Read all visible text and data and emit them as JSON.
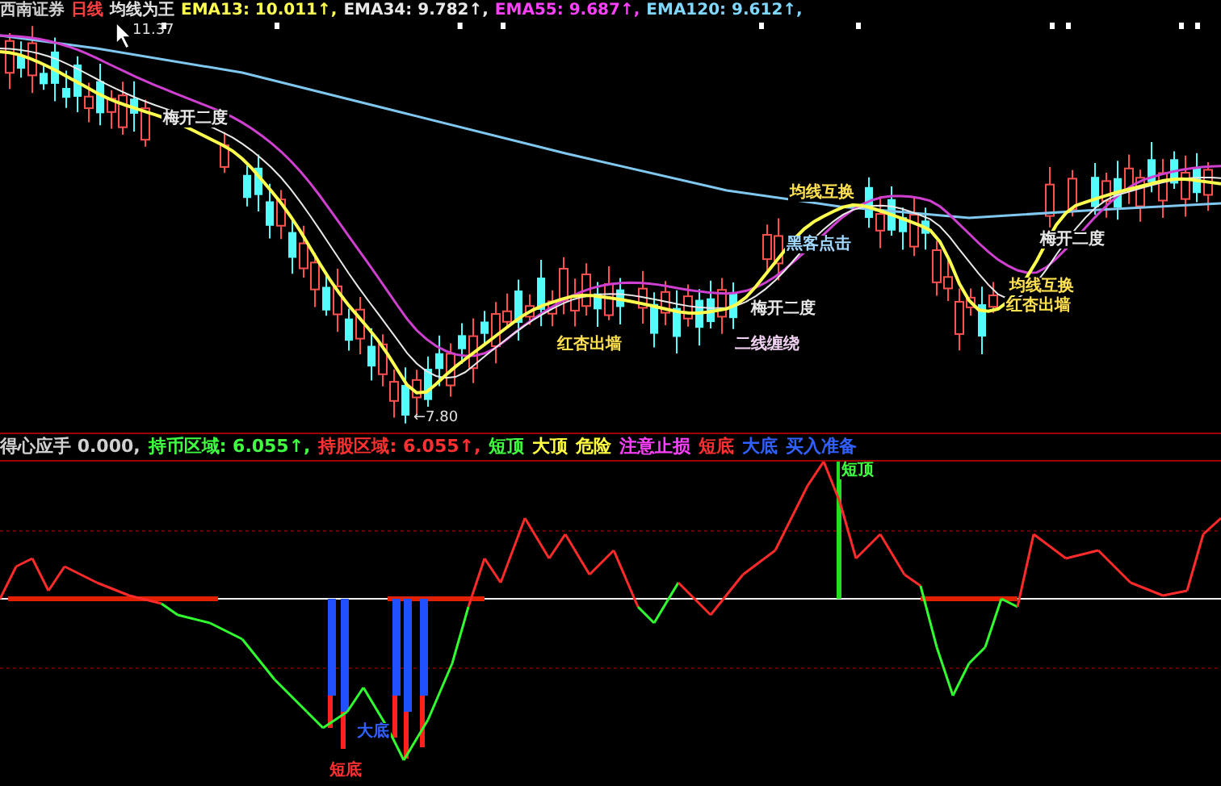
{
  "price_panel": {
    "legend": [
      {
        "text": "西南证券",
        "color": "#d0d0d0"
      },
      {
        "text": "日线",
        "color": "#ff4040"
      },
      {
        "text": "均线为王",
        "color": "#e0e0e0"
      },
      {
        "text": "EMA13: 10.011↑,",
        "color": "#ffff50"
      },
      {
        "text": "EMA34: 9.782↑,",
        "color": "#e8e8e8"
      },
      {
        "text": "EMA55: 9.687↑,",
        "color": "#ff40ff"
      },
      {
        "text": "EMA120: 9.612↑,",
        "color": "#80d8ff"
      }
    ],
    "price_labels": [
      {
        "text": "11.37"
      },
      {
        "text": "←7.80"
      }
    ],
    "annotations": [
      {
        "text": "梅开二度",
        "color": "#e8e8e8"
      },
      {
        "text": "均线互换",
        "color": "#ffe050"
      },
      {
        "text": "红杏出墙",
        "color": "#ffe050"
      },
      {
        "text": "梅开二度",
        "color": "#e8e8e8"
      },
      {
        "text": "黑客点击",
        "color": "#a0d8ff"
      },
      {
        "text": "二线缠绕",
        "color": "#f0d0f0"
      },
      {
        "text": "梅开二度",
        "color": "#e8e8e8"
      },
      {
        "text": "均线互换",
        "color": "#ffe050"
      },
      {
        "text": "红杏出墙",
        "color": "#ffe050"
      }
    ]
  },
  "indicator_panel": {
    "legend": [
      {
        "text": "得心应手 0.000,",
        "color": "#d0d0d0"
      },
      {
        "text": "持币区域: 6.055↑,",
        "color": "#40ff40"
      },
      {
        "text": "持股区域: 6.055↑,",
        "color": "#ff3030"
      },
      {
        "text": "短顶",
        "color": "#40ff40"
      },
      {
        "text": "大顶",
        "color": "#ffff40"
      },
      {
        "text": "危险",
        "color": "#ffff40"
      },
      {
        "text": "注意止损",
        "color": "#ff40ff"
      },
      {
        "text": "短底",
        "color": "#ff3030"
      },
      {
        "text": "大底",
        "color": "#3060ff"
      },
      {
        "text": "买入准备",
        "color": "#3060ff"
      }
    ],
    "annotations": [
      {
        "text": "短顶",
        "color": "#40ff40"
      },
      {
        "text": "大底",
        "color": "#3060ff"
      },
      {
        "text": "短底",
        "color": "#ff3030"
      }
    ]
  }
}
